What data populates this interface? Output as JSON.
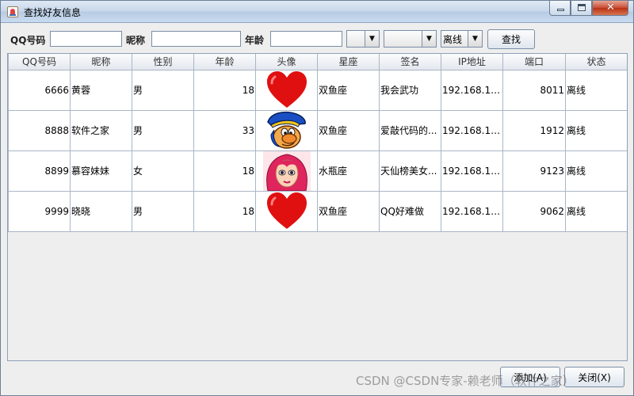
{
  "window": {
    "title": "查找好友信息"
  },
  "search": {
    "qq_label": "QQ号码",
    "qq_value": "",
    "nick_label": "昵称",
    "nick_value": "",
    "age_label": "年龄",
    "age_value": "",
    "combo1_value": "",
    "combo2_value": "",
    "status_value": "离线",
    "search_button": "查找"
  },
  "table": {
    "columns": [
      "QQ号码",
      "昵称",
      "性别",
      "年龄",
      "头像",
      "星座",
      "签名",
      "IP地址",
      "端口",
      "状态"
    ],
    "rows": [
      {
        "qq": "6666",
        "nick": "黄蓉",
        "sex": "男",
        "age": "18",
        "avatar": "heart-icon",
        "star": "双鱼座",
        "sign": "我会武功",
        "ip": "192.168.11...",
        "port": "8011",
        "status": "离线"
      },
      {
        "qq": "8888",
        "nick": "软件之家",
        "sex": "男",
        "age": "33",
        "avatar": "cartoon-boy-icon",
        "star": "双鱼座",
        "sign": "爱敲代码的...",
        "ip": "192.168.11...",
        "port": "1912",
        "status": "离线"
      },
      {
        "qq": "8899",
        "nick": "慕容妹妹",
        "sex": "女",
        "age": "18",
        "avatar": "cartoon-girl-icon",
        "star": "水瓶座",
        "sign": "天仙榜美女...",
        "ip": "192.168.11...",
        "port": "9123",
        "status": "离线"
      },
      {
        "qq": "9999",
        "nick": "晓晓",
        "sex": "男",
        "age": "18",
        "avatar": "heart-icon",
        "star": "双鱼座",
        "sign": "QQ好难做",
        "ip": "192.168.11...",
        "port": "9062",
        "status": "离线"
      }
    ]
  },
  "footer": {
    "add_button": "添加(A)",
    "close_button": "关闭(X)",
    "watermark": "CSDN @CSDN专家-赖老师（软件之家）"
  },
  "colors": {
    "titlebar": "#c6d6ea",
    "heart": "#e01010",
    "close_btn": "#c84b33"
  }
}
